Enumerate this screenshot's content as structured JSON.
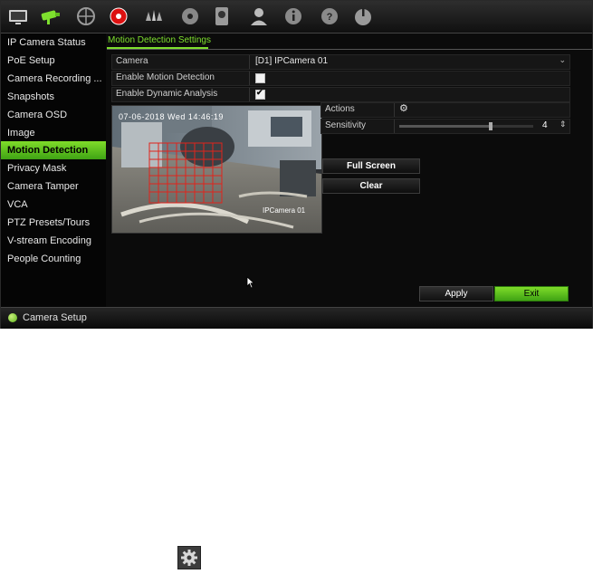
{
  "toolbar": {
    "icons": [
      "monitor-icon",
      "camera-icon",
      "network-icon",
      "record-icon",
      "alarm-icon",
      "hdd-icon",
      "storage-icon",
      "user-icon",
      "info-icon",
      "help-icon",
      "power-icon"
    ],
    "active": "camera-icon",
    "accent": "#7ee02e"
  },
  "sidebar": {
    "items": [
      {
        "label": "IP Camera Status"
      },
      {
        "label": "PoE Setup"
      },
      {
        "label": "Camera Recording ..."
      },
      {
        "label": "Snapshots"
      },
      {
        "label": "Camera OSD"
      },
      {
        "label": "Image"
      },
      {
        "label": "Motion Detection"
      },
      {
        "label": "Privacy Mask"
      },
      {
        "label": "Camera Tamper"
      },
      {
        "label": "VCA"
      },
      {
        "label": "PTZ Presets/Tours"
      },
      {
        "label": "V-stream Encoding"
      },
      {
        "label": "People Counting"
      }
    ],
    "active_index": 6
  },
  "main": {
    "tab": "Motion Detection Settings",
    "camera_label": "Camera",
    "camera_value": "[D1] IPCamera 01",
    "enable_motion_label": "Enable Motion Detection",
    "enable_motion_checked": false,
    "enable_dynamic_label": "Enable Dynamic Analysis",
    "enable_dynamic_checked": true,
    "dynamic_checkmark": "✔",
    "preview_timestamp": "07-06-2018 Wed 14:46:19",
    "preview_name": "IPCamera 01",
    "actions_label": "Actions",
    "sensitivity_label": "Sensitivity",
    "sensitivity_value": "4",
    "full_screen_label": "Full Screen",
    "clear_label": "Clear",
    "apply_label": "Apply",
    "exit_label": "Exit"
  },
  "statusbar": {
    "text": "Camera Setup"
  }
}
